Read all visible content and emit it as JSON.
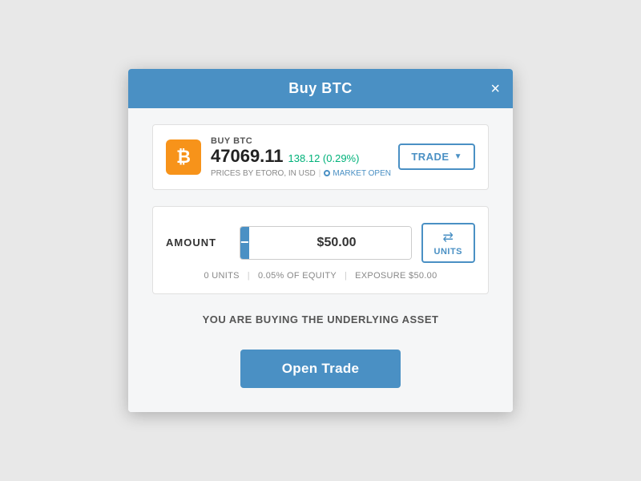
{
  "modal": {
    "title": "Buy BTC",
    "close_label": "×"
  },
  "asset": {
    "icon_symbol": "₿",
    "buy_label": "BUY BTC",
    "price": "47069.11",
    "change": "138.12 (0.29%)",
    "meta": "PRICES BY ETORO, IN USD",
    "market_status": "MARKET OPEN"
  },
  "trade_dropdown": {
    "label": "TRADE",
    "arrow": "▼"
  },
  "amount": {
    "label": "AMOUNT",
    "value": "$50.00",
    "minus": "−",
    "plus": "+"
  },
  "units_toggle": {
    "icon": "⇄",
    "label": "UNITS"
  },
  "stats": {
    "units": "0 UNITS",
    "equity": "0.05% OF EQUITY",
    "exposure": "EXPOSURE $50.00"
  },
  "message": "YOU ARE BUYING THE UNDERLYING ASSET",
  "cta": {
    "label": "Open Trade"
  }
}
